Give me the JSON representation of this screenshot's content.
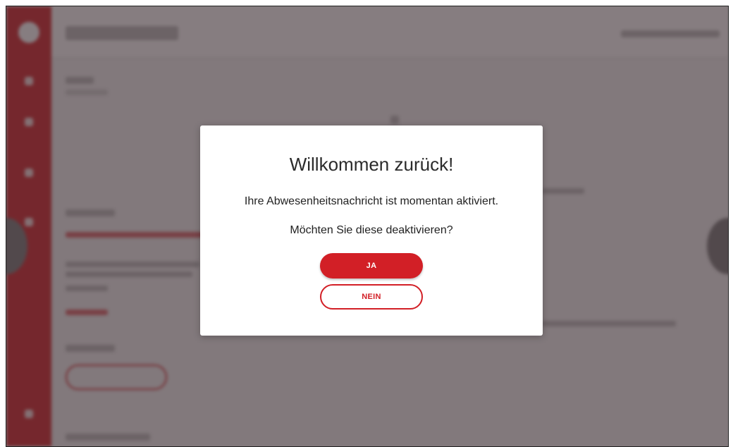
{
  "colors": {
    "accent": "#d21f26",
    "overlay": "#3c2d32",
    "dialog_bg": "#ffffff"
  },
  "dialog": {
    "title": "Willkommen zurück!",
    "message_line1": "Ihre Abwesenheitsnachricht ist momentan aktiviert.",
    "message_line2": "Möchten Sie diese deaktivieren?",
    "yes_label": "JA",
    "no_label": "NEIN"
  }
}
